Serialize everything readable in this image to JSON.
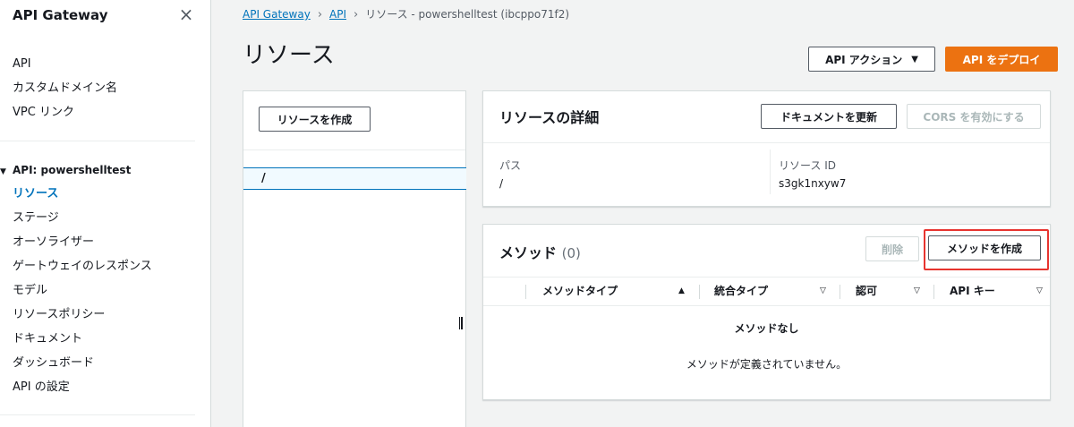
{
  "sidebar": {
    "title": "API Gateway",
    "close_icon": "×",
    "top_links": [
      "API",
      "カスタムドメイン名",
      "VPC リンク"
    ],
    "group_label": "API: powershelltest",
    "group_caret": "▼",
    "group_items": [
      {
        "label": "リソース",
        "active": true
      },
      {
        "label": "ステージ"
      },
      {
        "label": "オーソライザー"
      },
      {
        "label": "ゲートウェイのレスポンス"
      },
      {
        "label": "モデル"
      },
      {
        "label": "リソースポリシー"
      },
      {
        "label": "ドキュメント"
      },
      {
        "label": "ダッシュボード"
      },
      {
        "label": "API の設定"
      }
    ]
  },
  "breadcrumb": {
    "items": [
      "API Gateway",
      "API"
    ],
    "separator": "›",
    "current": "リソース - powershelltest (ibcppo71f2)"
  },
  "page": {
    "title": "リソース",
    "actions_label": "API アクション",
    "actions_caret": "▼",
    "deploy_label": "API をデプロイ"
  },
  "tree": {
    "create_resource_label": "リソースを作成",
    "selected_path": "/"
  },
  "details": {
    "title": "リソースの詳細",
    "update_docs_label": "ドキュメントを更新",
    "enable_cors_label": "CORS を有効にする",
    "path_label": "パス",
    "path_value": "/",
    "id_label": "リソース ID",
    "id_value": "s3gk1nxyw7"
  },
  "methods": {
    "title": "メソッド",
    "count": "(0)",
    "delete_label": "削除",
    "create_label": "メソッドを作成",
    "columns": [
      {
        "label": "メソッドタイプ",
        "sort": "▲"
      },
      {
        "label": "統合タイプ",
        "sort": "▽"
      },
      {
        "label": "認可",
        "sort": "▽"
      },
      {
        "label": "API キー",
        "sort": "▽"
      }
    ],
    "empty_title": "メソッドなし",
    "empty_desc": "メソッドが定義されていません。"
  },
  "colors": {
    "accent": "#0073bb",
    "primary_button": "#ec7211",
    "highlight_box": "#e7342f"
  }
}
